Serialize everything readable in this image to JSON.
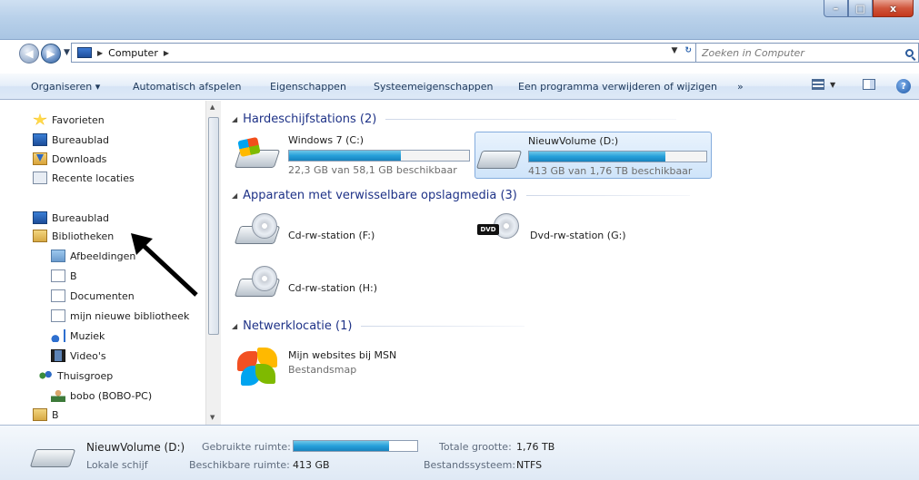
{
  "window": {
    "caption_min": "–",
    "caption_max": "□",
    "caption_close": "x"
  },
  "address_bar": {
    "segment": "Computer",
    "search_placeholder": "Zoeken in Computer"
  },
  "command_bar": {
    "items": [
      "Organiseren ▾",
      "Automatisch afspelen",
      "Eigenschappen",
      "Systeemeigenschappen",
      "Een programma verwijderen of wijzigen",
      "»"
    ]
  },
  "nav_pane": {
    "items": [
      {
        "label": "Favorieten",
        "icon": "star-icon"
      },
      {
        "label": "Bureaublad",
        "icon": "desktop-icon"
      },
      {
        "label": "Downloads",
        "icon": "downloads-icon"
      },
      {
        "label": "Recente locaties",
        "icon": "recent-places-icon"
      },
      {
        "label": "Bureaublad",
        "icon": "desktop-icon"
      },
      {
        "label": "Bibliotheken",
        "icon": "libraries-icon"
      },
      {
        "label": "Afbeeldingen",
        "icon": "pictures-icon"
      },
      {
        "label": "B",
        "icon": "library-icon"
      },
      {
        "label": "Documenten",
        "icon": "documents-icon"
      },
      {
        "label": "mijn nieuwe bibliotheek",
        "icon": "library-icon"
      },
      {
        "label": "Muziek",
        "icon": "music-icon"
      },
      {
        "label": "Video's",
        "icon": "video-icon"
      },
      {
        "label": "Thuisgroep",
        "icon": "homegroup-icon"
      },
      {
        "label": "bobo (BOBO-PC)",
        "icon": "user-icon"
      },
      {
        "label": "B",
        "icon": "folder-icon"
      }
    ]
  },
  "groups": {
    "hdd": "Hardeschijfstations (2)",
    "removable": "Apparaten met verwisselbare opslagmedia (3)",
    "network": "Netwerklocatie (1)"
  },
  "drives": {
    "c": {
      "name": "Windows 7 (C:)",
      "free": "22,3 GB van 58,1 GB beschikbaar",
      "used_fraction": 0.62
    },
    "d": {
      "name": "NieuwVolume (D:)",
      "free": "413 GB van 1,76 TB beschikbaar",
      "used_fraction": 0.77
    },
    "f": {
      "name": "Cd-rw-station (F:)"
    },
    "g": {
      "name": "Dvd-rw-station (G:)",
      "tag": "DVD"
    },
    "h": {
      "name": "Cd-rw-station (H:)"
    }
  },
  "network_location": {
    "name": "Mijn websites bij MSN",
    "type": "Bestandsmap"
  },
  "details": {
    "name": "NieuwVolume (D:)",
    "type": "Lokale schijf",
    "used_label": "Gebruikte ruimte:",
    "used_fraction": 0.77,
    "free_label": "Beschikbare ruimte:",
    "free_value": "413 GB",
    "total_label": "Totale grootte:",
    "total_value": "1,76 TB",
    "fs_label": "Bestandssysteem:",
    "fs_value": "NTFS"
  },
  "colors": {
    "accent": "#26a0da",
    "group_heading": "#1e3287",
    "selection": "#cfe4fa"
  }
}
